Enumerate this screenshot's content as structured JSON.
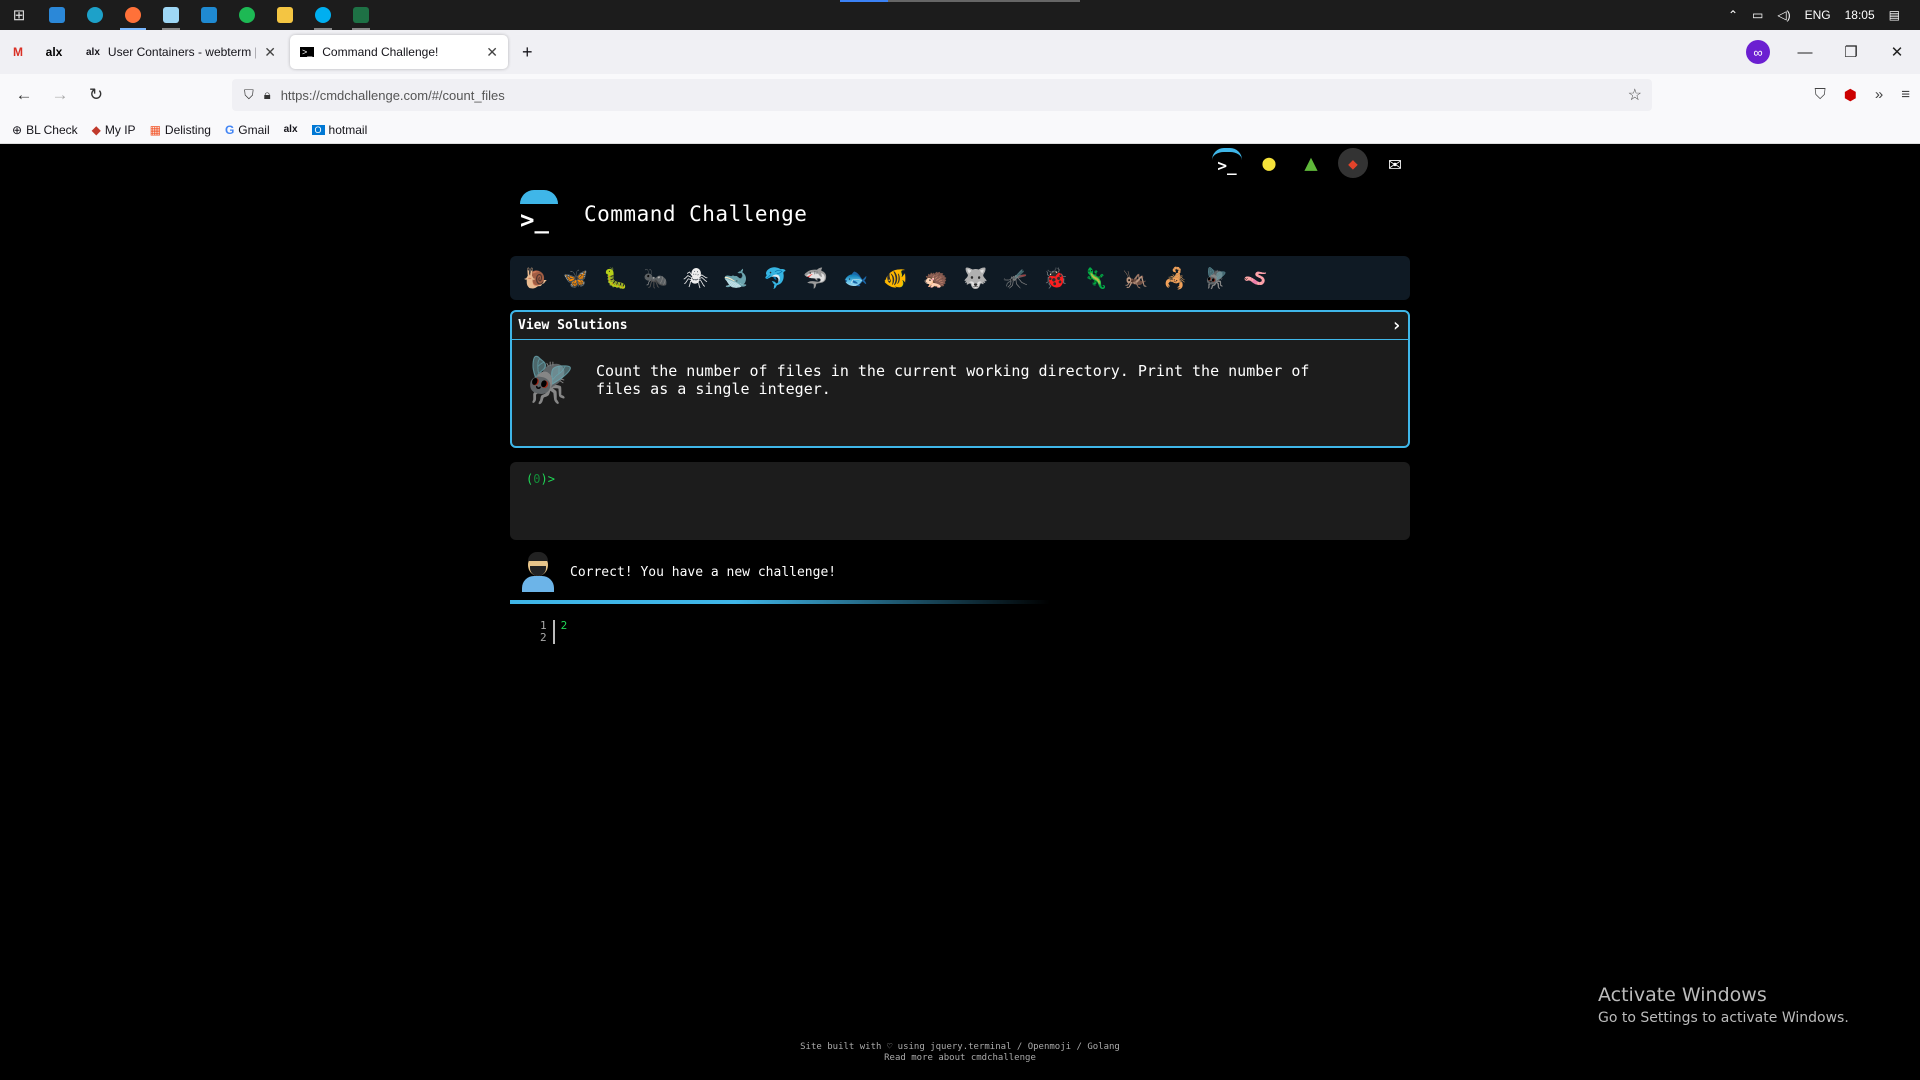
{
  "taskbar": {
    "apps": [
      {
        "name": "windows-start",
        "glyph": "⊞"
      },
      {
        "name": "mail",
        "glyph": "✉"
      },
      {
        "name": "edge",
        "glyph": "◐"
      },
      {
        "name": "firefox",
        "glyph": "●"
      },
      {
        "name": "notepad",
        "glyph": "▤"
      },
      {
        "name": "vscode",
        "glyph": "⋈"
      },
      {
        "name": "spotify",
        "glyph": "◉"
      },
      {
        "name": "file-explorer",
        "glyph": "▭"
      },
      {
        "name": "skype",
        "glyph": "S"
      },
      {
        "name": "excel",
        "glyph": "X"
      }
    ],
    "language": "ENG",
    "time": "18:05"
  },
  "browser": {
    "tabs": [
      {
        "title": "User Containers - webterm | ALX",
        "close": "✕"
      },
      {
        "title": "Command Challenge!",
        "close": "✕"
      }
    ],
    "pinned_tab_labels": [
      "M",
      "alx"
    ],
    "new_tab": "+",
    "url": "https://cmdchallenge.com/#/count_files",
    "bookmarks": [
      {
        "label": "BL Check",
        "icon": "globe-icon"
      },
      {
        "label": "My IP",
        "icon": "diamond-icon"
      },
      {
        "label": "Delisting",
        "icon": "windows-icon"
      },
      {
        "label": "Gmail",
        "icon": "google-icon"
      },
      {
        "label": "",
        "icon": "alx-icon",
        "text": "alx"
      },
      {
        "label": "hotmail",
        "icon": "outlook-icon"
      }
    ]
  },
  "page": {
    "title": "Command Challenge",
    "top_icons": [
      "terminal-icon",
      "lightbulb-icon",
      "tree-icon",
      "gitlab-icon",
      "mail-icon"
    ],
    "challenge_icons": [
      "🐌",
      "🦋",
      "🐛",
      "🐜",
      "🕷",
      "🐋",
      "🐬",
      "🦈",
      "🐟",
      "🐠",
      "🦔",
      "🐺",
      "🦟",
      "🐞",
      "🦎",
      "🦗",
      "🦂",
      "🪰",
      "🪱"
    ],
    "solutions": {
      "label": "View Solutions",
      "chevron": "›",
      "description": "Count the number of files in the current working directory. Print the number of files as a single integer."
    },
    "terminal": {
      "prompt_open": "(",
      "prompt_num": "0",
      "prompt_close": ")>"
    },
    "message": "Correct! You have a new challenge!",
    "editor": {
      "line_numbers": [
        "1",
        "2"
      ],
      "content": "2"
    },
    "activate": {
      "title": "Activate Windows",
      "subtitle": "Go to Settings to activate Windows."
    },
    "footer": {
      "line1": "Site built with ♡ using jquery.terminal / Openmoji / Golang",
      "line2": "Read more about cmdchallenge"
    }
  }
}
